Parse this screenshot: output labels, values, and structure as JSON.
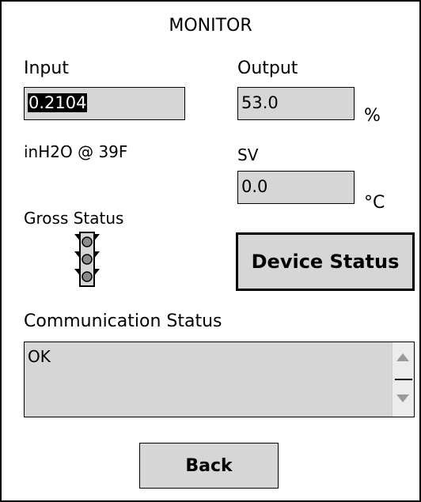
{
  "header": {
    "title": "MONITOR"
  },
  "input": {
    "label": "Input",
    "value": "0.2104",
    "units": "inH2O @ 39F"
  },
  "output": {
    "label": "Output",
    "value": "53.0",
    "unit": "%"
  },
  "sv": {
    "label": "SV",
    "value": "0.0",
    "unit": "°C"
  },
  "gross_status": {
    "label": "Gross Status",
    "icon": "traffic-light-icon"
  },
  "device_status_button": {
    "label": "Device Status"
  },
  "communication": {
    "label": "Communication Status",
    "value": "OK"
  },
  "back_button": {
    "label": "Back"
  }
}
